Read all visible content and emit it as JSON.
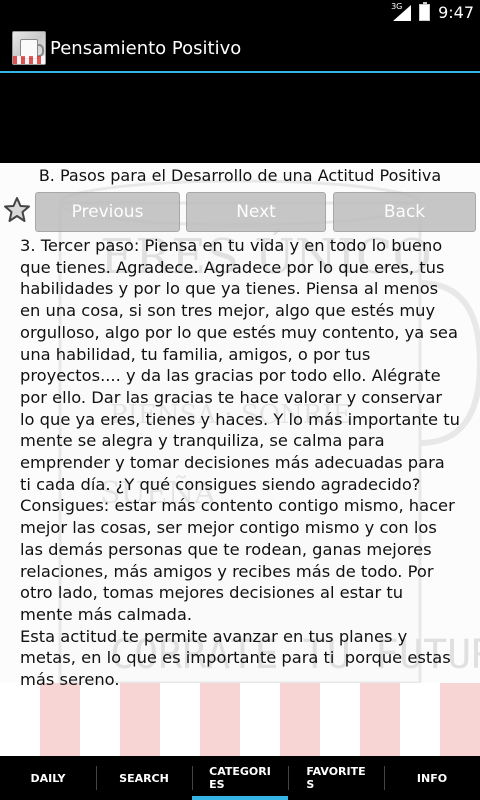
{
  "status_bar": {
    "network": "3G",
    "time": "9:47"
  },
  "action_bar": {
    "title": "Pensamiento Positivo",
    "icon": "app-mug-icon"
  },
  "content": {
    "heading": "B. Pasos para el Desarrollo de una Actitud Positiva",
    "nav": {
      "previous": "Previous",
      "next": "Next",
      "back": "Back"
    },
    "favorite_icon": "star-outline-icon",
    "paragraph": "3. Tercer paso: Piensa en tu vida y en todo lo bueno que tienes. Agradece. Agradece por lo que eres, tus habilidades y por lo que ya tienes. Piensa al menos en una cosa, si son tres mejor, algo que estés muy orgulloso, algo por lo que estés muy contento, ya sea una habilidad, tu familia, amigos, o por tus proyectos.... y da las gracias por todo ello. Alégrate por ello. Dar las gracias te hace valorar y conservar lo que ya eres, tienes y haces. Y lo más importante tu mente se alegra y tranquiliza, se calma para emprender y tomar decisiones más adecuadas para ti cada día. ¿Y qué consigues siendo agradecido? Consigues: estar más contento contigo mismo, hacer mejor las cosas, ser mejor contigo mismo y con los las demás personas que te rodean, ganas mejores relaciones, más amigos y recibes más de todo. Por otro lado, tomas mejores decisiones al estar tu mente más calmada.\nEsta actitud te permite avanzar en tus planes y metas, en lo que es importante para ti  porque estas más sereno."
  },
  "tabs": [
    {
      "label": "DAILY"
    },
    {
      "label": "SEARCH"
    },
    {
      "label": "CATEGORIES",
      "display": "CATEGORI\nES"
    },
    {
      "label": "FAVORITES",
      "display": "FAVORITE\nS"
    },
    {
      "label": "INFO"
    }
  ],
  "colors": {
    "accent": "#33b5e5",
    "button_bg": "#bdbdbd",
    "background": "#000000"
  }
}
